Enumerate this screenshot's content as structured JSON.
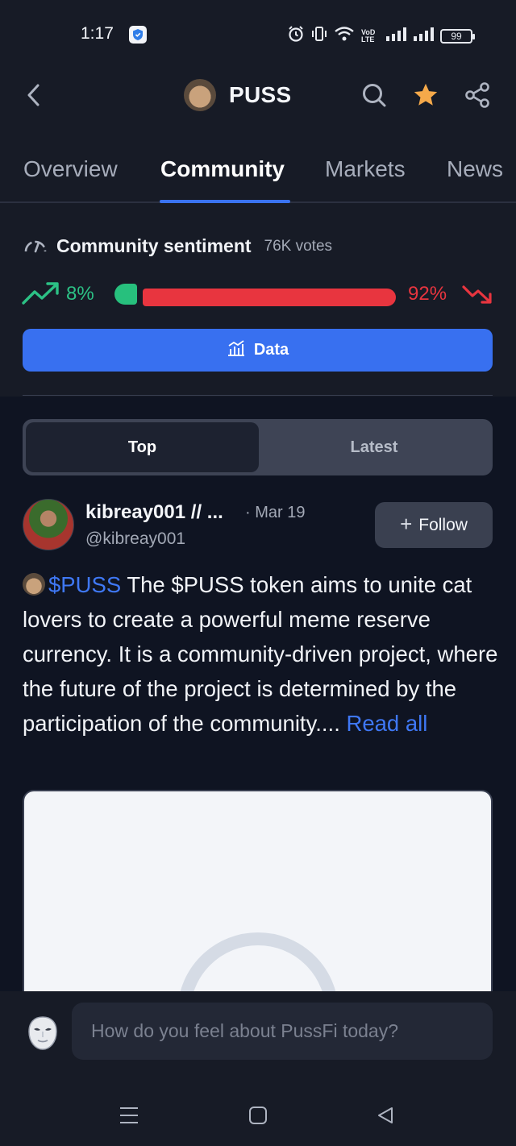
{
  "status_bar": {
    "time": "1:17",
    "network_label": "VoD LTE",
    "battery": "99"
  },
  "header": {
    "coin_symbol": "PUSS",
    "icons": [
      "back-icon",
      "search-icon",
      "star-icon",
      "share-icon"
    ],
    "star_color": "#f5a94a"
  },
  "tabs": [
    {
      "label": "Overview",
      "active": false
    },
    {
      "label": "Community",
      "active": true
    },
    {
      "label": "Markets",
      "active": false
    },
    {
      "label": "News",
      "active": false
    }
  ],
  "sentiment": {
    "title": "Community sentiment",
    "votes": "76K votes",
    "bullish_pct_label": "8%",
    "bearish_pct_label": "92%",
    "bullish_fraction": 0.08,
    "bearish_fraction": 0.92,
    "bull_color": "#27c07d",
    "bear_color": "#e8353f",
    "data_button_label": "Data"
  },
  "feed_tabs": {
    "top_label": "Top",
    "latest_label": "Latest",
    "selected": "Top"
  },
  "post": {
    "author": "kibreay001 // ...",
    "date": "· Mar 19",
    "handle": "@kibreay001",
    "follow_label": "Follow",
    "ticker": "$PUSS",
    "text": " The $PUSS token aims to unite cat lovers to create a powerful meme reserve currency. It is a community-driven project, where the future of the project is determined by the participation of the community.... ",
    "read_all": "Read all"
  },
  "composer": {
    "placeholder": "How do you feel about PussFi today?"
  },
  "colors": {
    "accent": "#3870f0",
    "background": "#171b26",
    "feed_background": "#0f1422"
  }
}
